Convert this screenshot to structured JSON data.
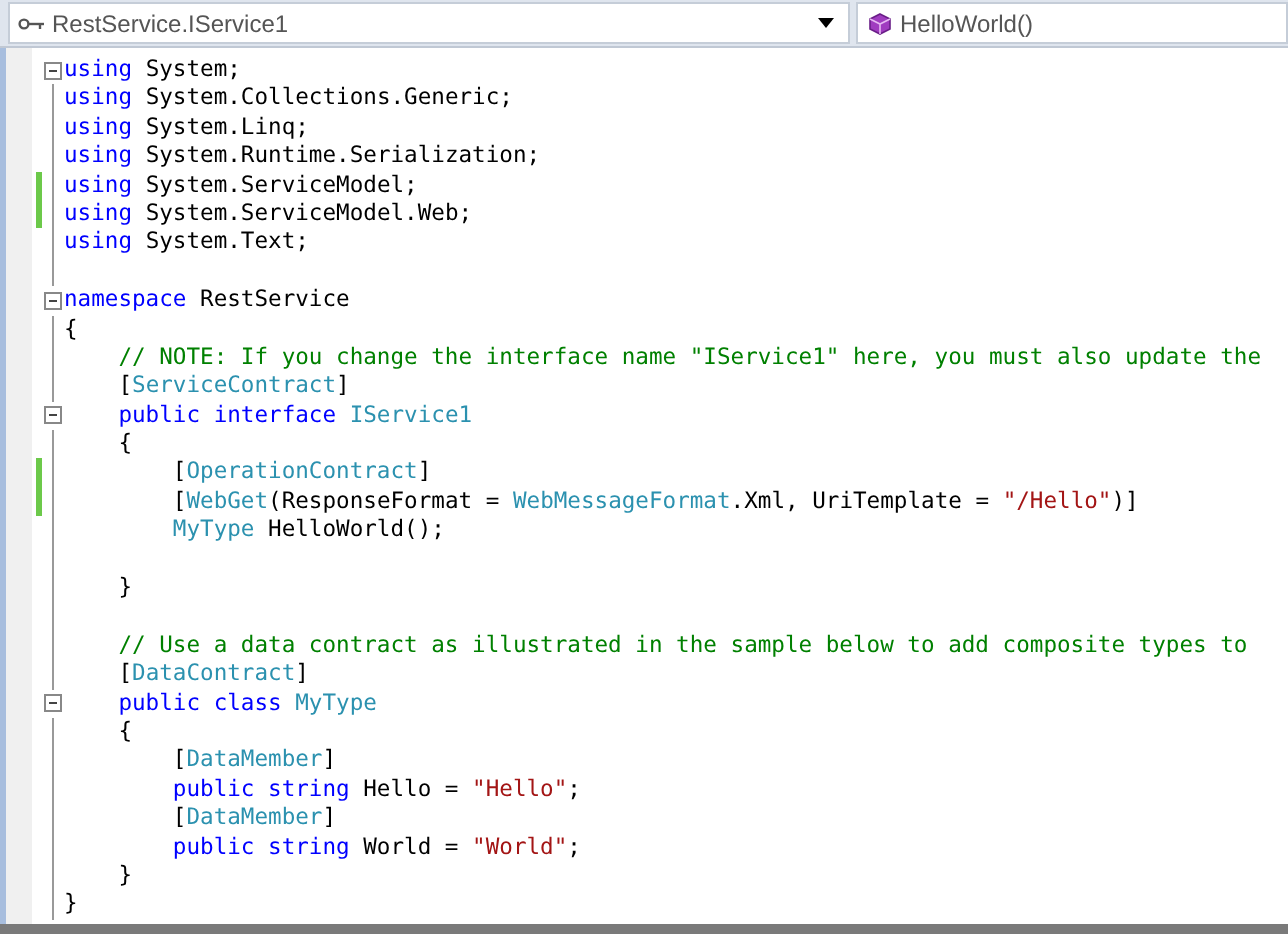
{
  "navigation_bar": {
    "type_dropdown": {
      "value": "RestService.IService1"
    },
    "member_dropdown": {
      "value": "HelloWorld()"
    }
  },
  "code_lines": [
    {
      "expanded": true,
      "changed": false,
      "tokens": [
        {
          "kind": "keyword",
          "text": "using"
        },
        {
          "kind": "plain",
          "text": " System;"
        }
      ]
    },
    {
      "changed": false,
      "tokens": [
        {
          "kind": "keyword",
          "text": "using"
        },
        {
          "kind": "plain",
          "text": " System.Collections.Generic;"
        }
      ]
    },
    {
      "changed": false,
      "tokens": [
        {
          "kind": "keyword",
          "text": "using"
        },
        {
          "kind": "plain",
          "text": " System.Linq;"
        }
      ]
    },
    {
      "changed": false,
      "tokens": [
        {
          "kind": "keyword",
          "text": "using"
        },
        {
          "kind": "plain",
          "text": " System.Runtime.Serialization;"
        }
      ]
    },
    {
      "changed": true,
      "tokens": [
        {
          "kind": "keyword",
          "text": "using"
        },
        {
          "kind": "plain",
          "text": " System.ServiceModel;"
        }
      ]
    },
    {
      "changed": true,
      "tokens": [
        {
          "kind": "keyword",
          "text": "using"
        },
        {
          "kind": "plain",
          "text": " System.ServiceModel.Web;"
        }
      ]
    },
    {
      "changed": false,
      "tokens": [
        {
          "kind": "keyword",
          "text": "using"
        },
        {
          "kind": "plain",
          "text": " System.Text;"
        }
      ]
    },
    {
      "kind": "blank"
    },
    {
      "expanded": true,
      "changed": false,
      "tokens": [
        {
          "kind": "keyword",
          "text": "namespace"
        },
        {
          "kind": "plain",
          "text": " RestService"
        }
      ]
    },
    {
      "changed": false,
      "tokens": [
        {
          "kind": "plain",
          "text": "{"
        }
      ]
    },
    {
      "changed": false,
      "tokens": [
        {
          "kind": "comment",
          "text": "    // NOTE: If you change the interface name \"IService1\" here, you must also update the"
        }
      ]
    },
    {
      "changed": false,
      "tokens": [
        {
          "kind": "plain",
          "text": "    ["
        },
        {
          "kind": "type",
          "text": "ServiceContract"
        },
        {
          "kind": "plain",
          "text": "]"
        }
      ]
    },
    {
      "expanded": true,
      "changed": false,
      "tokens": [
        {
          "kind": "keyword",
          "text": "    public interface"
        },
        {
          "kind": "type",
          "text": " IService1"
        }
      ]
    },
    {
      "changed": false,
      "tokens": [
        {
          "kind": "plain",
          "text": "    {"
        }
      ]
    },
    {
      "changed": true,
      "tokens": [
        {
          "kind": "plain",
          "text": "        ["
        },
        {
          "kind": "type",
          "text": "OperationContract"
        },
        {
          "kind": "plain",
          "text": "]"
        }
      ]
    },
    {
      "changed": true,
      "tokens": [
        {
          "kind": "plain",
          "text": "        ["
        },
        {
          "kind": "type",
          "text": "WebGet"
        },
        {
          "kind": "plain",
          "text": "(ResponseFormat = "
        },
        {
          "kind": "type",
          "text": "WebMessageFormat"
        },
        {
          "kind": "plain",
          "text": ".Xml, UriTemplate = "
        },
        {
          "kind": "string",
          "text": "\"/Hello\""
        },
        {
          "kind": "plain",
          "text": ")]"
        }
      ]
    },
    {
      "changed": false,
      "tokens": [
        {
          "kind": "type",
          "text": "        MyType"
        },
        {
          "kind": "plain",
          "text": " HelloWorld();"
        }
      ]
    },
    {
      "kind": "blank"
    },
    {
      "changed": false,
      "tokens": [
        {
          "kind": "plain",
          "text": "    }"
        }
      ]
    },
    {
      "kind": "blank"
    },
    {
      "changed": false,
      "tokens": [
        {
          "kind": "comment",
          "text": "    // Use a data contract as illustrated in the sample below to add composite types to"
        }
      ]
    },
    {
      "changed": false,
      "tokens": [
        {
          "kind": "plain",
          "text": "    ["
        },
        {
          "kind": "type",
          "text": "DataContract"
        },
        {
          "kind": "plain",
          "text": "]"
        }
      ]
    },
    {
      "expanded": true,
      "changed": false,
      "tokens": [
        {
          "kind": "keyword",
          "text": "    public class"
        },
        {
          "kind": "type",
          "text": " MyType"
        }
      ]
    },
    {
      "changed": false,
      "tokens": [
        {
          "kind": "plain",
          "text": "    {"
        }
      ]
    },
    {
      "changed": false,
      "tokens": [
        {
          "kind": "plain",
          "text": "        ["
        },
        {
          "kind": "type",
          "text": "DataMember"
        },
        {
          "kind": "plain",
          "text": "]"
        }
      ]
    },
    {
      "changed": false,
      "tokens": [
        {
          "kind": "keyword",
          "text": "        public string"
        },
        {
          "kind": "plain",
          "text": " Hello = "
        },
        {
          "kind": "string",
          "text": "\"Hello\""
        },
        {
          "kind": "plain",
          "text": ";"
        }
      ]
    },
    {
      "changed": false,
      "tokens": [
        {
          "kind": "plain",
          "text": "        ["
        },
        {
          "kind": "type",
          "text": "DataMember"
        },
        {
          "kind": "plain",
          "text": "]"
        }
      ]
    },
    {
      "changed": false,
      "tokens": [
        {
          "kind": "keyword",
          "text": "        public string"
        },
        {
          "kind": "plain",
          "text": " World = "
        },
        {
          "kind": "string",
          "text": "\"World\""
        },
        {
          "kind": "plain",
          "text": ";"
        }
      ]
    },
    {
      "changed": false,
      "tokens": [
        {
          "kind": "plain",
          "text": "    }"
        }
      ]
    },
    {
      "changed": false,
      "tokens": [
        {
          "kind": "plain",
          "text": "}"
        }
      ]
    }
  ]
}
